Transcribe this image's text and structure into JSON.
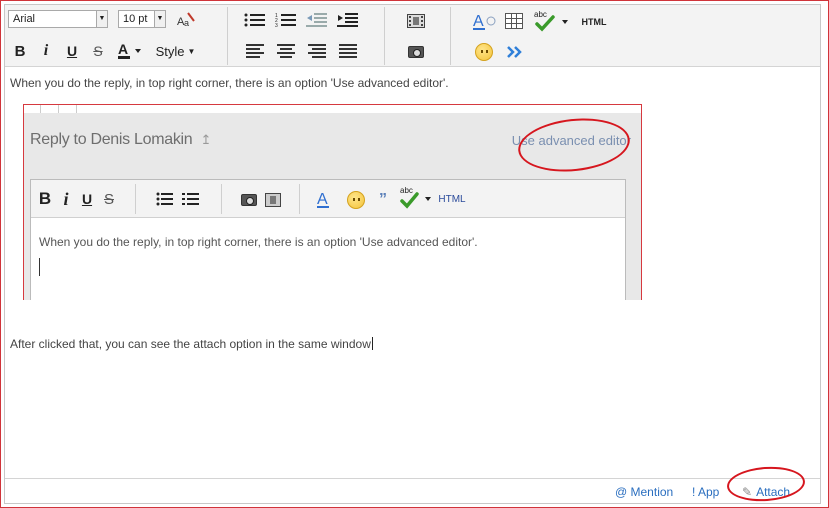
{
  "toolbar": {
    "font_family": "Arial",
    "font_size": "10 pt",
    "style_label": "Style",
    "html_label": "HTML",
    "abc_label": "abc"
  },
  "content": {
    "paragraph1": "When you do the reply, in top right corner, there is an option 'Use advanced editor'.",
    "paragraph2": "After clicked that, you can see the attach option in the same window",
    "embedded": {
      "title": "Reply to Denis Lomakin",
      "advanced_link": "Use advanced editor",
      "html_label": "HTML",
      "abc_label": "abc",
      "body_text": "When you do the reply, in top right corner, there is an option 'Use advanced editor'."
    }
  },
  "footer": {
    "mention": "@ Mention",
    "app": "! App",
    "attach": "Attach"
  },
  "colors": {
    "annotation_red": "#d6161e",
    "link_blue": "#2a6ebf",
    "arrow_blue": "#2f7fd8"
  }
}
